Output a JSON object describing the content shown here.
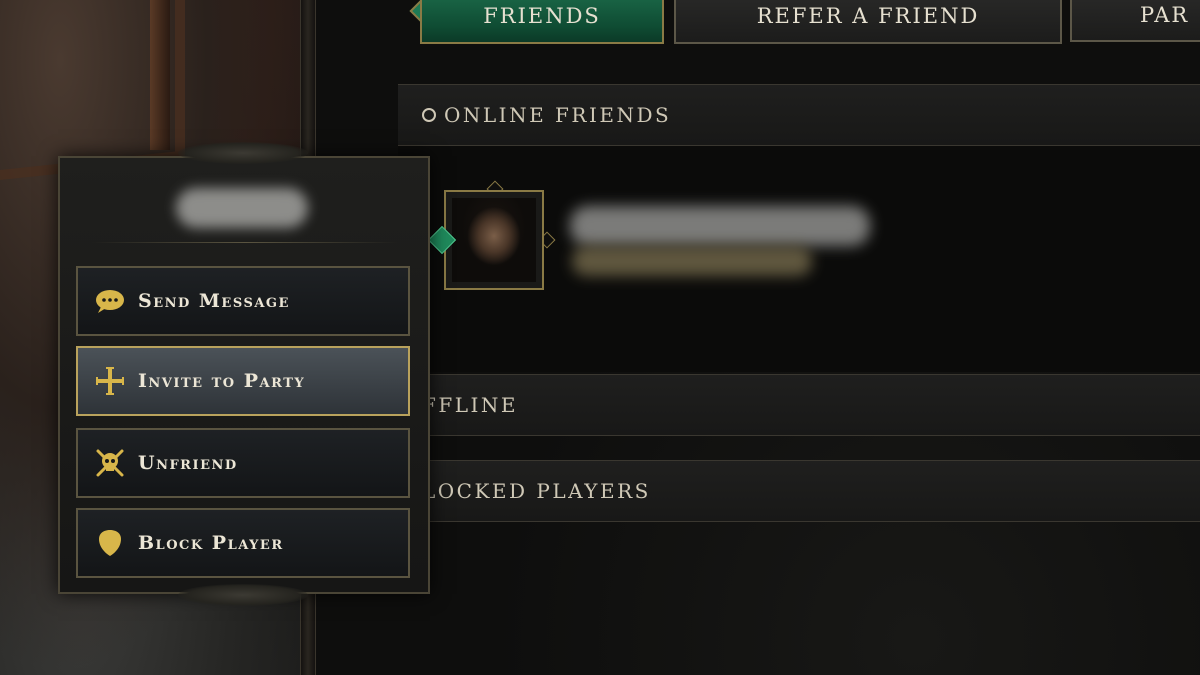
{
  "tabs": [
    {
      "label": "Friends",
      "active": true
    },
    {
      "label": "Refer a Friend",
      "active": false
    },
    {
      "label": "Par",
      "active": false
    }
  ],
  "sections": {
    "online": "Online Friends",
    "offline": "ffline",
    "blocked": "locked Players"
  },
  "context_menu": {
    "items": [
      {
        "label": "Send Message",
        "icon": "chat-bubble-icon"
      },
      {
        "label": "Invite to Party",
        "icon": "cross-icon"
      },
      {
        "label": "Unfriend",
        "icon": "skull-crossbones-icon"
      },
      {
        "label": "Block Player",
        "icon": "shield-icon"
      }
    ]
  },
  "colors": {
    "accent_gold": "#b9a25c",
    "active_tab_green": "#1c6b4a",
    "online_status": "#1f8a5c",
    "background": "#0e0e0d"
  }
}
